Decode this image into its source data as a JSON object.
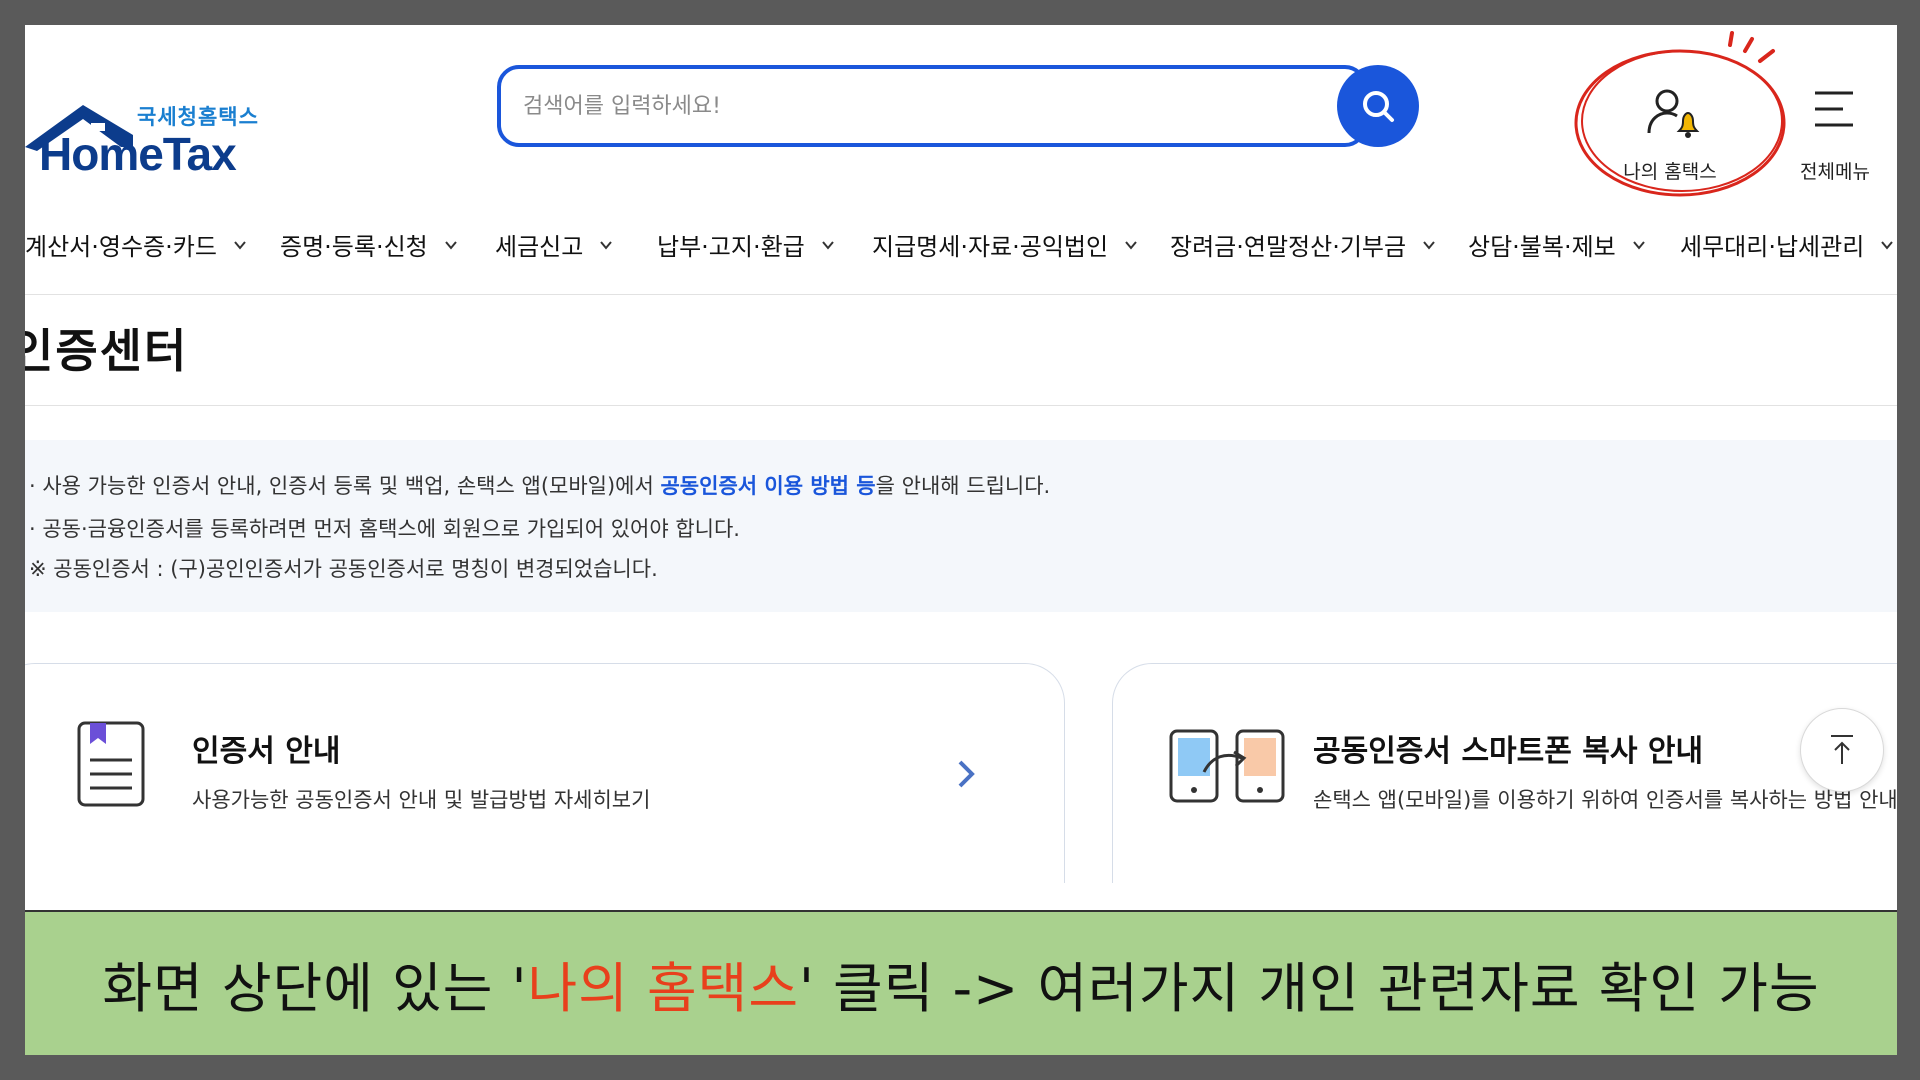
{
  "header": {
    "logo_sub": "국세청홈택스",
    "logo_main": "HomeTax",
    "search_placeholder": "검색어를 입력하세요!",
    "my_hometax_label": "나의 홈택스",
    "all_menu_label": "전체메뉴"
  },
  "nav": {
    "items": [
      {
        "label": "계산서·영수증·카드"
      },
      {
        "label": "증명·등록·신청"
      },
      {
        "label": "세금신고"
      },
      {
        "label": "납부·고지·환급"
      },
      {
        "label": "지급명세·자료·공익법인"
      },
      {
        "label": "장려금·연말정산·기부금"
      },
      {
        "label": "상담·불복·제보"
      },
      {
        "label": "세무대리·납세관리"
      }
    ]
  },
  "page": {
    "title": "인증센터"
  },
  "notice": {
    "line1_prefix": "· 사용 가능한 인증서 안내, 인증서 등록 및 백업, 손택스 앱(모바일)에서 ",
    "line1_highlight": "공동인증서 이용 방법 등",
    "line1_suffix": "을 안내해 드립니다.",
    "line2": "· 공동·금융인증서를 등록하려면 먼저 홈택스에 회원으로 가입되어 있어야 합니다.",
    "line3": "※ 공동인증서 : (구)공인인증서가 공동인증서로 명칭이 변경되었습니다."
  },
  "cards": [
    {
      "title": "인증서 안내",
      "desc": "사용가능한 공동인증서 안내 및 발급방법 자세히보기"
    },
    {
      "title": "공동인증서 스마트폰 복사 안내",
      "desc": "손택스 앱(모바일)를 이용하기 위하여 인증서를 복사하는 방법 안내"
    }
  ],
  "caption": {
    "prefix": "화면 상단에 있는 '",
    "highlight": "나의 홈택스",
    "suffix": "' 클릭 -> 여러가지 개인 관련자료 확인 가능"
  },
  "colors": {
    "primary_blue": "#1a56db",
    "logo_navy": "#0c3c8c",
    "annotation_red": "#d9261c",
    "caption_bg": "#a9d18e",
    "caption_highlight": "#e8401c",
    "bell_yellow": "#f2b705"
  }
}
